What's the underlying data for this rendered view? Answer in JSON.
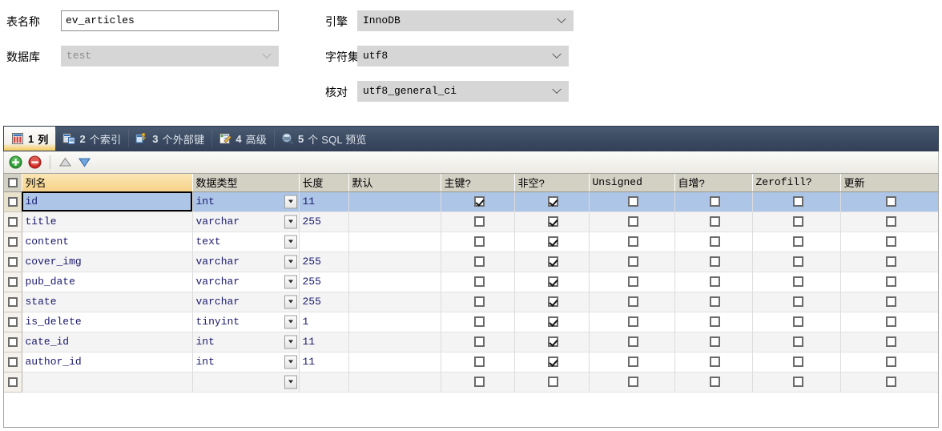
{
  "form": {
    "table_name_label": "表名称",
    "table_name_value": "ev_articles",
    "database_label": "数据库",
    "database_value": "test",
    "engine_label": "引擎",
    "engine_value": "InnoDB",
    "charset_label": "字符集",
    "charset_value": "utf8",
    "collation_label": "核对",
    "collation_value": "utf8_general_ci"
  },
  "tabs": [
    {
      "num": "1",
      "label": "列",
      "icon": "columns-icon",
      "active": true
    },
    {
      "num": "2",
      "label": "个索引",
      "icon": "index-icon",
      "active": false
    },
    {
      "num": "3",
      "label": "个外部键",
      "icon": "foreign-key-icon",
      "active": false
    },
    {
      "num": "4",
      "label": "高级",
      "icon": "advanced-icon",
      "active": false
    },
    {
      "num": "5",
      "label": "个 SQL 预览",
      "icon": "sql-preview-icon",
      "active": false
    }
  ],
  "toolbar": {
    "add_label": "add-column",
    "remove_label": "remove-column",
    "move_up_label": "move-up",
    "move_down_label": "move-down"
  },
  "grid": {
    "headers": [
      "列名",
      "数据类型",
      "长度",
      "默认",
      "主键?",
      "非空?",
      "Unsigned",
      "自增?",
      "Zerofill?",
      "更新"
    ],
    "highlight_header_index": 0,
    "rows": [
      {
        "name": "id",
        "type": "int",
        "length": "11",
        "default": "",
        "pk": true,
        "notnull": true,
        "unsigned": false,
        "autoinc": false,
        "zerofill": false,
        "update": false,
        "selected": true
      },
      {
        "name": "title",
        "type": "varchar",
        "length": "255",
        "default": "",
        "pk": false,
        "notnull": true,
        "unsigned": false,
        "autoinc": false,
        "zerofill": false,
        "update": false,
        "selected": false
      },
      {
        "name": "content",
        "type": "text",
        "length": "",
        "default": "",
        "pk": false,
        "notnull": true,
        "unsigned": false,
        "autoinc": false,
        "zerofill": false,
        "update": false,
        "selected": false
      },
      {
        "name": "cover_img",
        "type": "varchar",
        "length": "255",
        "default": "",
        "pk": false,
        "notnull": true,
        "unsigned": false,
        "autoinc": false,
        "zerofill": false,
        "update": false,
        "selected": false
      },
      {
        "name": "pub_date",
        "type": "varchar",
        "length": "255",
        "default": "",
        "pk": false,
        "notnull": true,
        "unsigned": false,
        "autoinc": false,
        "zerofill": false,
        "update": false,
        "selected": false
      },
      {
        "name": "state",
        "type": "varchar",
        "length": "255",
        "default": "",
        "pk": false,
        "notnull": true,
        "unsigned": false,
        "autoinc": false,
        "zerofill": false,
        "update": false,
        "selected": false
      },
      {
        "name": "is_delete",
        "type": "tinyint",
        "length": "1",
        "default": "",
        "pk": false,
        "notnull": true,
        "unsigned": false,
        "autoinc": false,
        "zerofill": false,
        "update": false,
        "selected": false
      },
      {
        "name": "cate_id",
        "type": "int",
        "length": "11",
        "default": "",
        "pk": false,
        "notnull": true,
        "unsigned": false,
        "autoinc": false,
        "zerofill": false,
        "update": false,
        "selected": false
      },
      {
        "name": "author_id",
        "type": "int",
        "length": "11",
        "default": "",
        "pk": false,
        "notnull": true,
        "unsigned": false,
        "autoinc": false,
        "zerofill": false,
        "update": false,
        "selected": false
      },
      {
        "name": "",
        "type": "",
        "length": "",
        "default": "",
        "pk": false,
        "notnull": false,
        "unsigned": false,
        "autoinc": false,
        "zerofill": false,
        "update": false,
        "selected": false
      }
    ]
  },
  "colors": {
    "tabstrip": "#3c4c63",
    "active_tab_accent": "#eec95f",
    "selected_row": "#adc5e7",
    "header": "#d3d0c4",
    "header_highlight": "#f6d28a"
  }
}
